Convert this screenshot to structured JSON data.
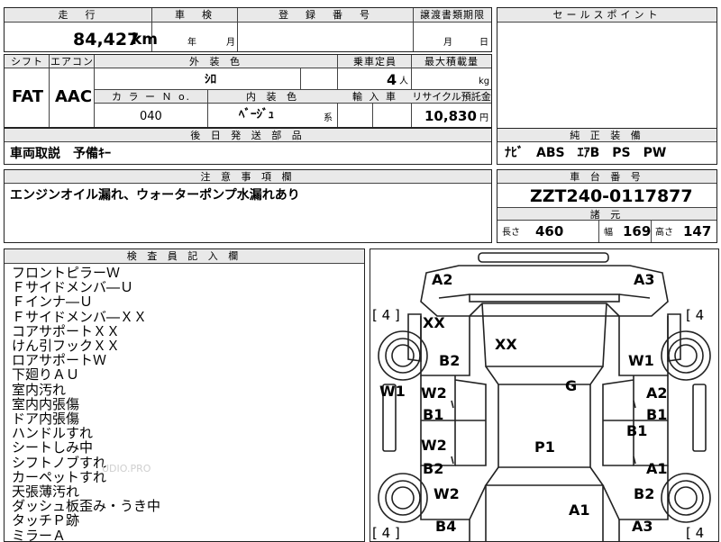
{
  "top": {
    "mileage_label": "走　行",
    "mileage_value": "84,427",
    "mileage_unit": "km",
    "shaken_label": "車　検",
    "shaken_year": "年",
    "shaken_month": "月",
    "reg_label": "登　録　番　号",
    "transfer_label": "譲渡書類期限",
    "transfer_month": "月",
    "transfer_day": "日"
  },
  "spec": {
    "shift_label": "シフト",
    "ac_label": "エアコン",
    "shift_value": "FAT",
    "ac_value": "AAC",
    "ext_color_label": "外 装 色",
    "ext_color_value": "ｼﾛ",
    "seats_label": "乗車定員",
    "seats_value": "4",
    "seats_unit": "人",
    "load_label": "最大積載量",
    "load_unit": "kg",
    "colorno_label": "カ ラ ー Ｎ o.",
    "colorno_value": "040",
    "int_color_label": "内 装 色",
    "int_color_value": "ﾍﾞｰｼﾞｭ",
    "int_color_suffix": "系",
    "import_label": "輸 入 車",
    "recycle_label": "リサイクル預託金",
    "recycle_value": "10,830",
    "recycle_unit": "円"
  },
  "later_parts": {
    "label": "後 日 発 送 部 品",
    "value": "車両取説　予備ｷｰ"
  },
  "notes": {
    "label": "注 意 事 項 欄",
    "value": "エンジンオイル漏れ、ウォーターポンプ水漏れあり"
  },
  "right": {
    "sales_point_label": "セールスポイント",
    "equipment_label": "純 正 装 備",
    "equipment_value": "ﾅﾋﾞ　ABS　ｴｱB　PS　PW",
    "chassis_label": "車 台 番 号",
    "chassis_value": "ZZT240-0117877",
    "dims_label": "諸 元",
    "length_label": "長さ",
    "length_value": "460",
    "width_label": "幅",
    "width_value": "169",
    "height_label": "高さ",
    "height_value": "147"
  },
  "inspector": {
    "label": "検 査 員 記 入 欄",
    "lines": [
      "フロントピラーＷ",
      "Ｆサイドメンバ―Ｕ",
      "Ｆインナ―Ｕ",
      "Ｆサイドメンバ―ＸＸ",
      "コアサポートＸＸ",
      "けん引フックＸＸ",
      "ロアサポートＷ",
      "下廻りＡＵ",
      "室内汚れ",
      "室内内張傷",
      "ドア内張傷",
      "ハンドルすれ",
      "シートしみ中",
      "シフトノブすれ",
      "カーペットすれ",
      "天張薄汚れ",
      "ダッシュ板歪み・うき中",
      "タッチＰ跡",
      "ミラーＡ"
    ],
    "watermark": "UDIO.PRO"
  },
  "diagram": {
    "tire_front_left": "[ 4 ]",
    "tire_front_right": "[ 4",
    "tire_rear_left": "[ 4 ]",
    "tire_rear_right": "[ 4",
    "marks": {
      "a2_top": "A2",
      "a3_top": "A3",
      "xx_fl": "XX",
      "xx_hood": "XX",
      "b2_fl": "B2",
      "w1_fr": "W1",
      "w1_left": "W1",
      "g": "G",
      "w2_l1": "W2",
      "b1_l1": "B1",
      "a2_r1": "A2",
      "b1_r1": "B1",
      "b1_rm": "B1",
      "w2_l2": "W2",
      "b2_l2": "B2",
      "p1": "P1",
      "a1_r2": "A1",
      "w2_l3": "W2",
      "b2_r3": "B2",
      "a1_bottom": "A1",
      "b4": "B4",
      "a3_bottom": "A3"
    }
  }
}
